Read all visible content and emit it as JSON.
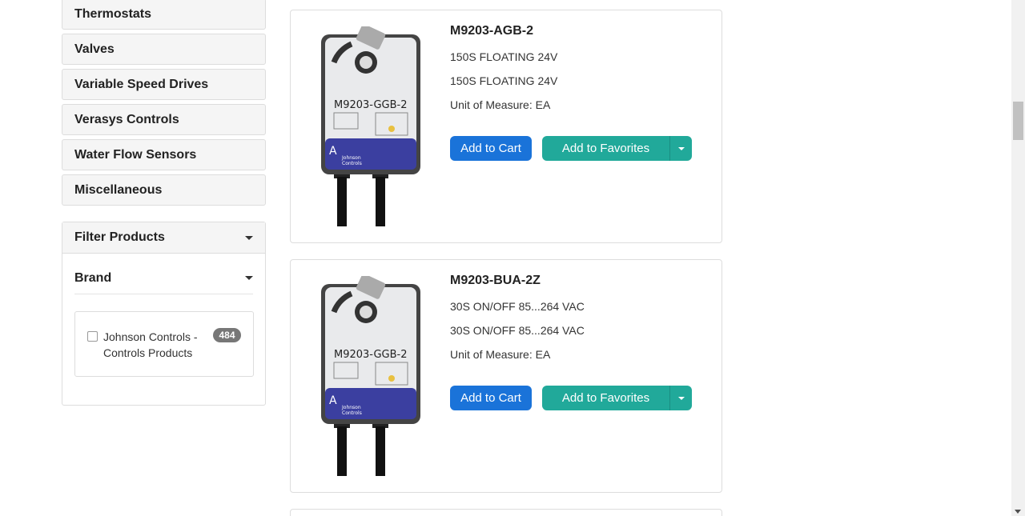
{
  "sidebar": {
    "categories": [
      "Thermostats",
      "Valves",
      "Variable Speed Drives",
      "Verasys Controls",
      "Water Flow Sensors",
      "Miscellaneous"
    ],
    "filter": {
      "title": "Filter Products",
      "brand_title": "Brand",
      "brands": [
        {
          "label": "Johnson Controls - Controls Products",
          "count": "484",
          "checked": false
        }
      ]
    }
  },
  "products": [
    {
      "name": "M9203-AGB-2",
      "desc1": "150S FLOATING 24V",
      "desc2": "150S FLOATING 24V",
      "uom": "Unit of Measure: EA",
      "image_model_text": "M9203-GGB-2",
      "add_to_cart": "Add to Cart",
      "add_to_favorites": "Add to Favorites"
    },
    {
      "name": "M9203-BUA-2Z",
      "desc1": "30S ON/OFF 85...264 VAC",
      "desc2": "30S ON/OFF 85...264 VAC",
      "uom": "Unit of Measure: EA",
      "image_model_text": "M9203-GGB-2",
      "add_to_cart": "Add to Cart",
      "add_to_favorites": "Add to Favorites"
    }
  ],
  "colors": {
    "cart_button": "#1a73d9",
    "favorites_button": "#21a99a",
    "badge": "#777777"
  }
}
